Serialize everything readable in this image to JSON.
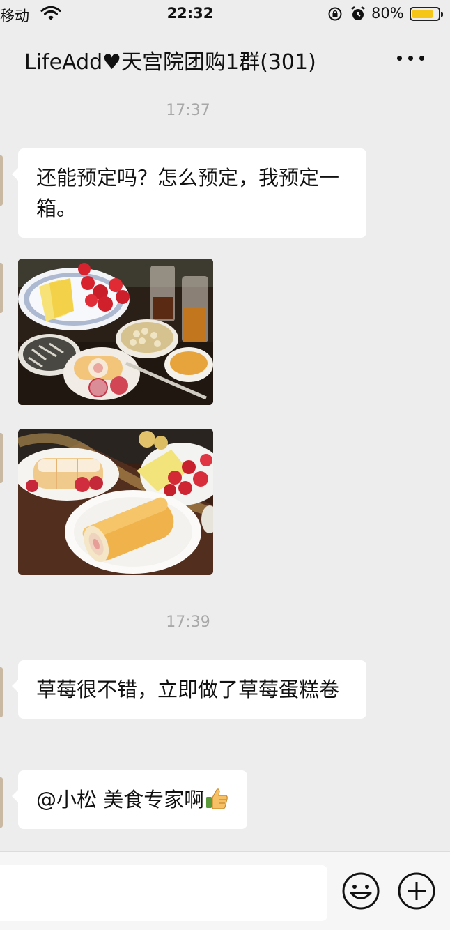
{
  "status_bar": {
    "carrier": "移动",
    "time": "22:32",
    "battery_percent": "80%",
    "battery_level": 0.8,
    "icons": [
      "wifi-icon",
      "rotation-lock-icon",
      "alarm-icon",
      "battery-icon"
    ]
  },
  "nav": {
    "title": "LifeAdd♥天宫院团购1群(301)",
    "more_icon": "more-dots-icon"
  },
  "messages": [
    {
      "type": "timestamp",
      "text": "17:37"
    },
    {
      "type": "text",
      "sender_side": "left",
      "text": "还能预定吗？怎么预定，我预定一箱。"
    },
    {
      "type": "image",
      "sender_side": "left",
      "description_icon": "photo-strawberry-platter"
    },
    {
      "type": "image",
      "sender_side": "left",
      "description_icon": "photo-cake-roll"
    },
    {
      "type": "timestamp",
      "text": "17:39"
    },
    {
      "type": "text",
      "sender_side": "left",
      "text": "草莓很不错，立即做了草莓蛋糕卷"
    },
    {
      "type": "text",
      "sender_side": "left",
      "text": "@小松 美食专家啊",
      "trailing_icon": "thumbs-up-icon"
    }
  ],
  "input_bar": {
    "value": "",
    "emoji_icon": "smiley-icon",
    "plus_icon": "plus-circle-icon"
  },
  "colors": {
    "background": "#ededed",
    "bubble": "#ffffff",
    "battery": "#f5c518",
    "timestamp": "#a8a8a8"
  }
}
